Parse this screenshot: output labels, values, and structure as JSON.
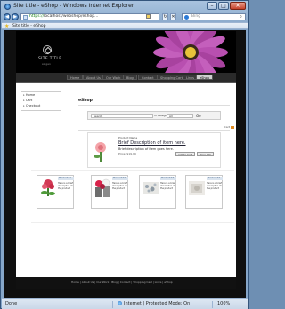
{
  "window": {
    "title": "Site title - eShop - Windows Internet Explorer",
    "minimize": "–",
    "maximize": "□",
    "close": "✕"
  },
  "navbar": {
    "back_icon": "back-arrow-icon",
    "forward_icon": "forward-arrow-icon",
    "address_prefix": "https://",
    "address_rest": "localhost/webshop/eshop...",
    "refresh": "↻",
    "stop": "✕",
    "search_placeholder": "Bing",
    "search_go": "⌕"
  },
  "favorites": {
    "tab_label": "Site title - eShop"
  },
  "banner": {
    "site_title": "SITE TITLE",
    "slogan": "slogan",
    "flower_petal_color": "#b84fb0",
    "flower_center_color": "#e7c43a"
  },
  "topnav": {
    "items": [
      "Home",
      "About Us",
      "Our Work",
      "Blog",
      "Contact",
      "Shopping Cart",
      "Links",
      "eShop"
    ],
    "active": "eShop"
  },
  "sidebar": {
    "items": [
      "Home",
      "Cart",
      "Checkout"
    ]
  },
  "eshop": {
    "title": "eShop",
    "search_value": "Search",
    "category_label": "in Category",
    "category_value": "All",
    "go_label": "Go",
    "cart_link": "Cart",
    "featured": {
      "name_label": "Product Name",
      "title": "Brief Description of item here.",
      "desc": "Brief description of item goes here.",
      "price": "Price: $19.99",
      "add_label": "Add to Cart",
      "more_label": "More Info"
    },
    "category_heading": "Category",
    "products": [
      {
        "head": "Product 01",
        "text": "Here is a brief description of the product"
      },
      {
        "head": "Product 02",
        "text": "Here is a brief description of the product"
      },
      {
        "head": "Product 03",
        "text": "Here is a brief description of the product"
      },
      {
        "head": "Product 04",
        "text": "Here is a brief description of the product"
      }
    ]
  },
  "footer": {
    "links": "Home  |  About Us  |  Our Work  |  Blog  |  Contact  |  Shopping Cart  |  Links  |  eShop"
  },
  "status": {
    "left": "Done",
    "zone": "Internet | Protected Mode: On",
    "zoom": "100%"
  }
}
